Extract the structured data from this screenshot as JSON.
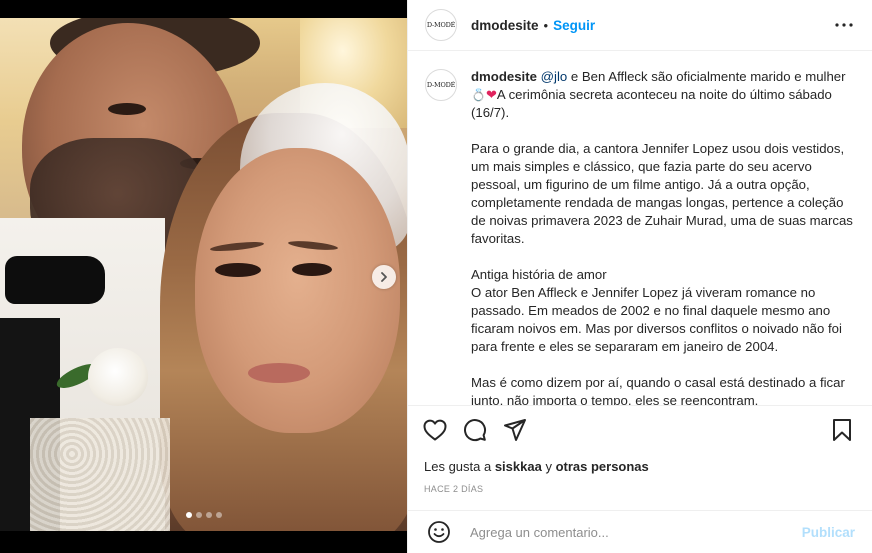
{
  "post": {
    "avatar_text": "D-MODÉ",
    "username": "dmodesite",
    "separator": "•",
    "follow_label": "Seguir",
    "caption": {
      "username": "dmodesite",
      "mention": "@jlo",
      "line1_rest": " e Ben Affleck são oficialmente marido e mulher ",
      "emoji_ring": "💍",
      "emoji_heart": "❤",
      "line1_tail": "A cerimônia secreta aconteceu na noite do último sábado (16/7).",
      "paragraph2": "Para o grande dia, a cantora Jennifer Lopez usou dois vestidos, um mais simples e clássico, que fazia parte do seu acervo pessoal, um figurino de um filme antigo. Já a outra opção, completamente rendada de mangas longas, pertence a coleção de noivas primavera 2023 de Zuhair Murad, uma de suas marcas favoritas.",
      "heading3": "Antiga história de amor",
      "paragraph3": "O ator Ben Affleck e Jennifer Lopez já viveram romance no passado. Em meados de 2002 e no final daquele mesmo ano ficaram noivos em. Mas por diversos conflitos o noivado não foi para frente e eles se separaram em janeiro de 2004.",
      "paragraph4": "Mas é como dizem por aí, quando o casal está destinado a ficar junto, não importa o tempo, eles se reencontram."
    },
    "likes": {
      "prefix": "Les gusta a ",
      "user": "siskkaa",
      "middle": " y ",
      "others": "otras personas"
    },
    "time_ago": "HACE 2 DÍAS",
    "comment_placeholder": "Agrega un comentario...",
    "publish_label": "Publicar",
    "carousel": {
      "total": 4,
      "active_index": 0
    }
  },
  "icons": [
    "more-icon",
    "heart-icon",
    "comment-icon",
    "share-icon",
    "save-icon",
    "emoji-icon",
    "next-arrow-icon"
  ],
  "colors": {
    "link": "#0095f6",
    "mention": "#00376b",
    "publish_disabled": "#b2dffc",
    "muted": "#8e8e8e"
  }
}
